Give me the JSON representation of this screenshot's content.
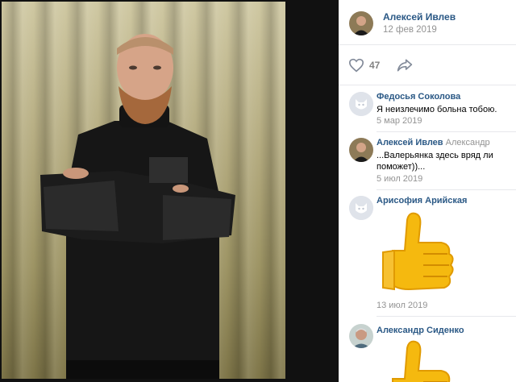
{
  "post": {
    "author": "Алексей Ивлев",
    "date": "12 фев 2019",
    "likes": "47"
  },
  "comments": [
    {
      "author": "Федосья Соколова",
      "text": "Я неизлечимо больна тобою.",
      "date": "5 мар 2019",
      "avatar": "dog-avatar"
    },
    {
      "author": "Алексей Ивлев",
      "reply_to": "Александр",
      "text": "...Валерьянка здесь вряд ли поможет))...",
      "date": "5 июл 2019",
      "avatar": "user-photo"
    },
    {
      "author": "Арисофия Арийская",
      "sticker": "thumbs-up",
      "date": "13 июл 2019",
      "avatar": "dog-avatar"
    },
    {
      "author": "Александр Сиденко",
      "sticker": "thumbs-up",
      "avatar": "user-photo"
    }
  ],
  "colors": {
    "link": "#2a5885",
    "meta": "#939393",
    "divider": "#e7e8ec"
  }
}
